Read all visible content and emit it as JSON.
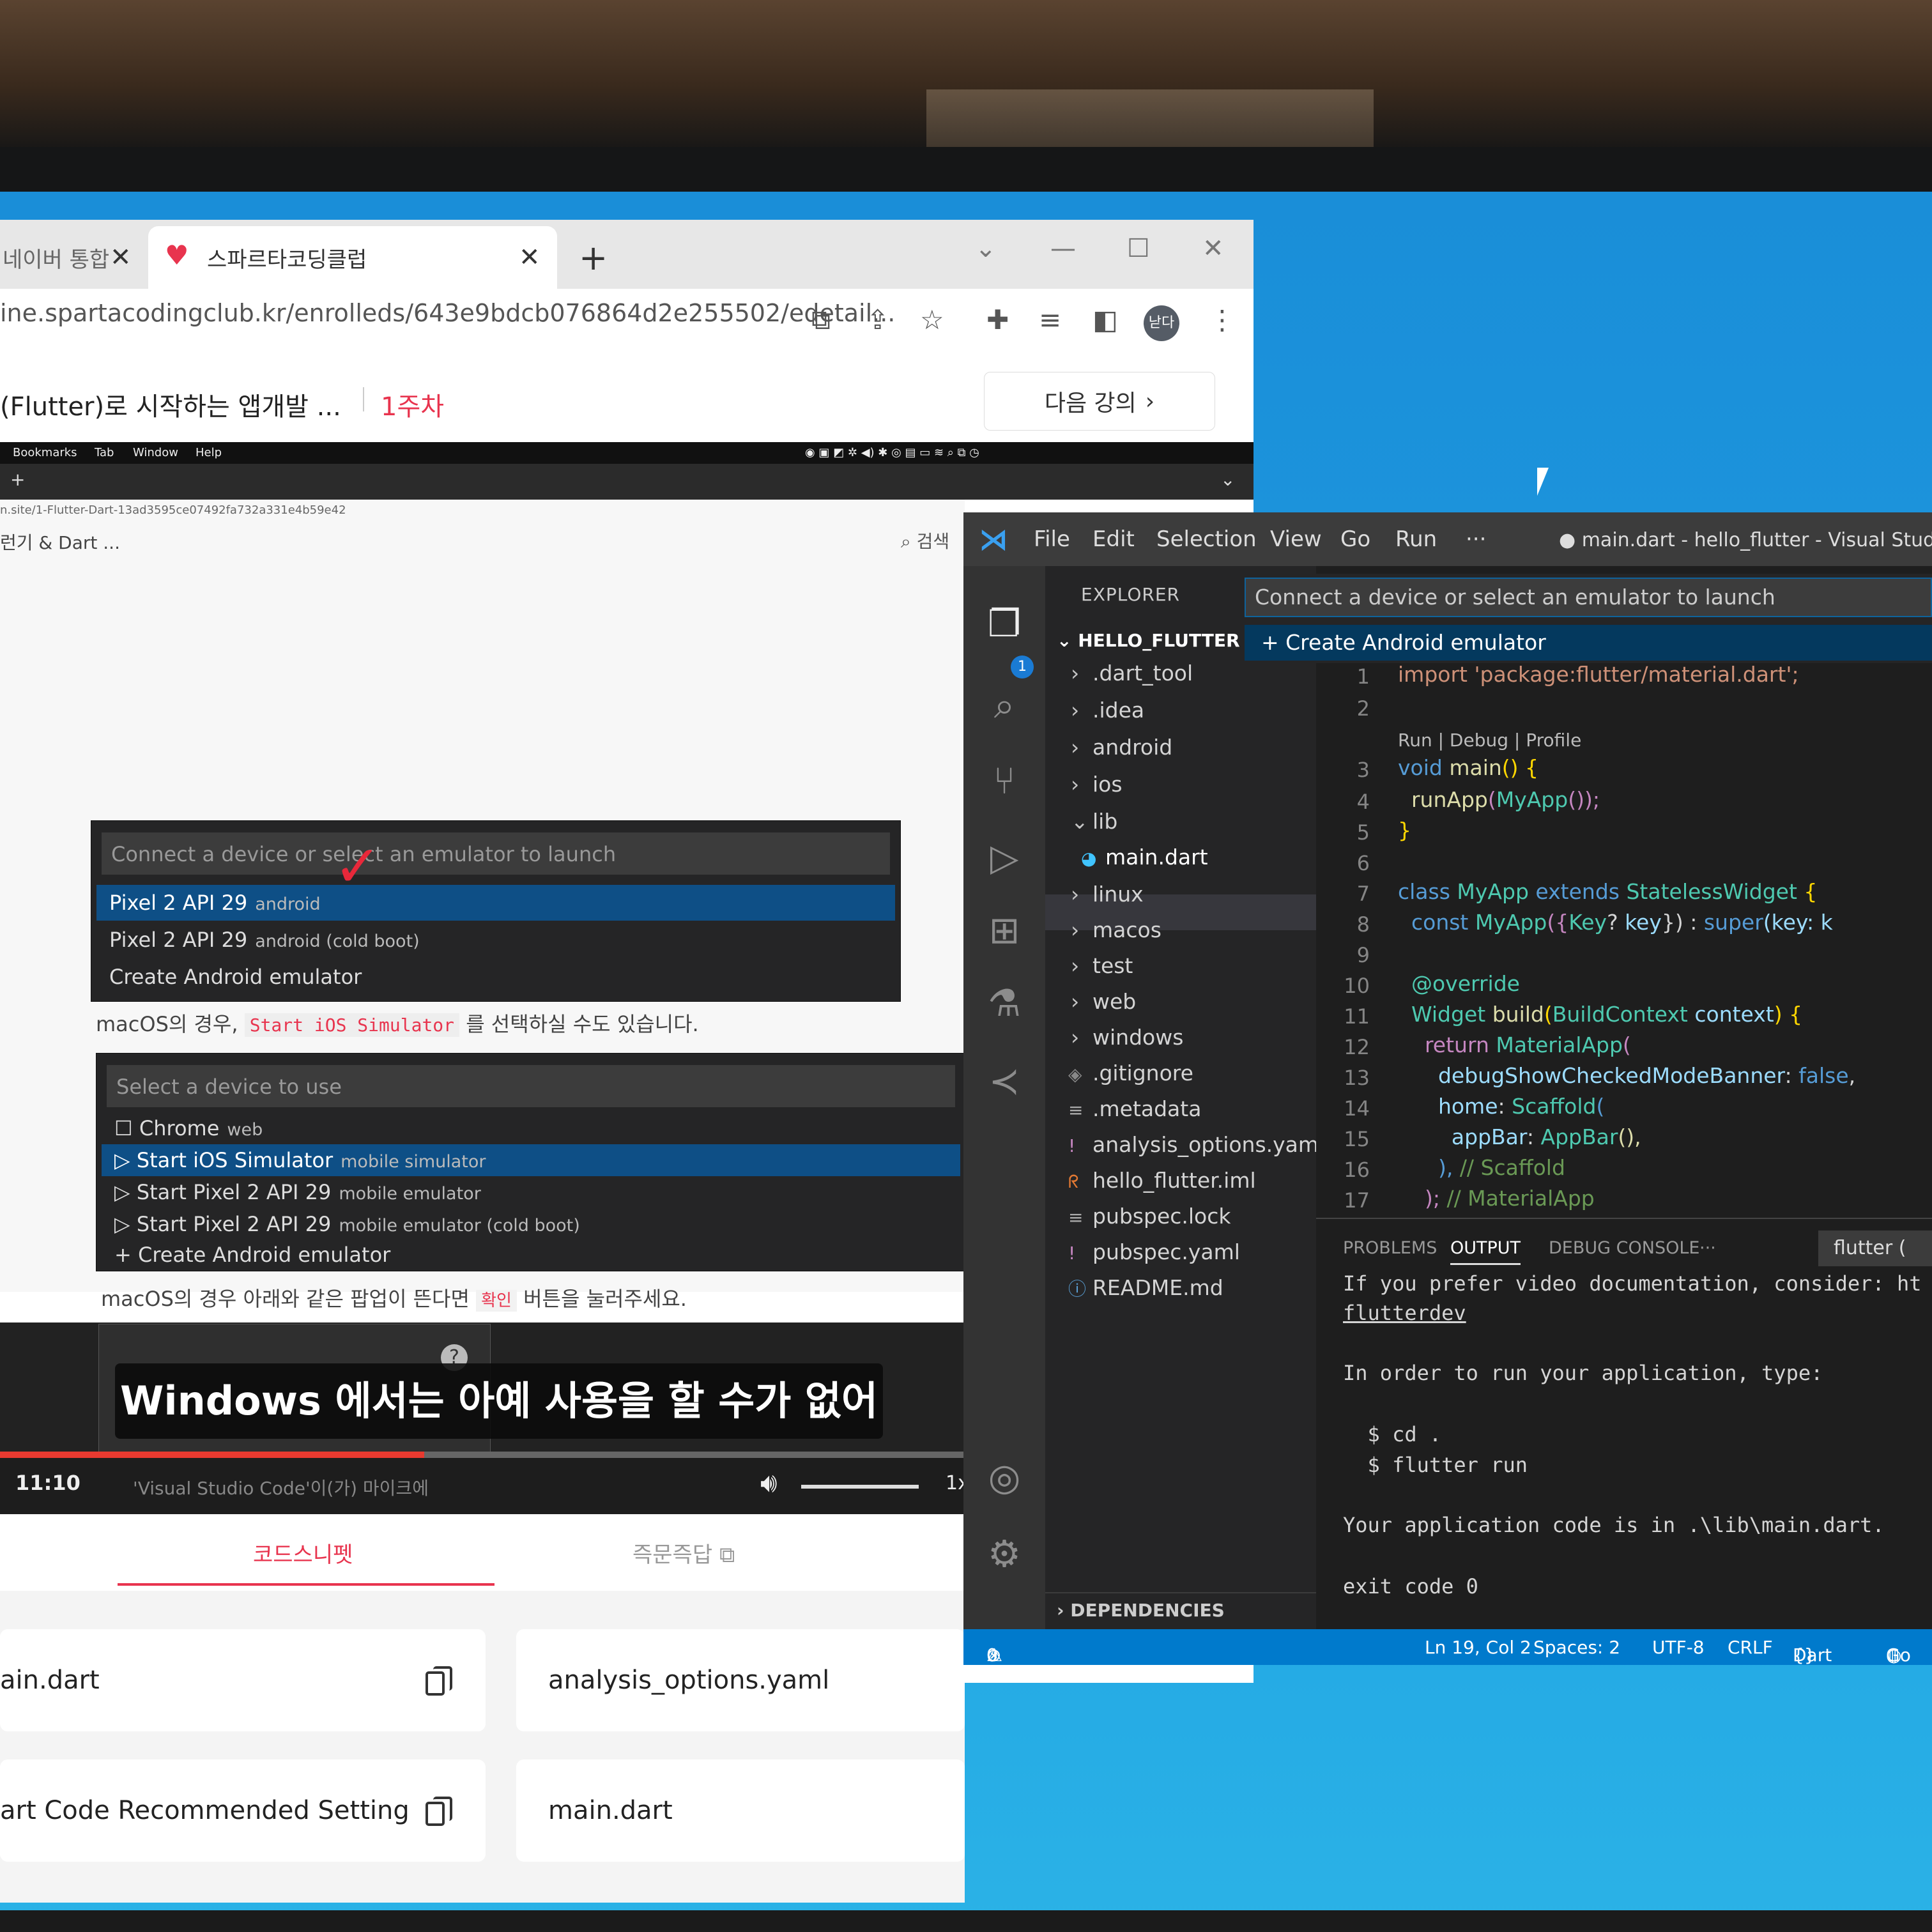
{
  "chrome": {
    "tab1_title": "네이버 통합",
    "tab2_title": "스파르타코딩클럽",
    "tab_close": "✕",
    "new_tab": "+",
    "url": "ine.spartacodingclub.kr/enrolleds/643e9bdcb076864d2e255502/edetail...",
    "profile_label": "낟다",
    "lecture_title": "(Flutter)로 시작하는 앱개발 ...",
    "week": "1주차",
    "next_lecture": "다음 강의"
  },
  "video": {
    "mac_menu": [
      "Bookmarks",
      "Tab",
      "Window",
      "Help"
    ],
    "mac_new_tab": "+",
    "inner_url": "n.site/1-Flutter-Dart-13ad3595ce07492fa732a331e4b59e42",
    "inner_heading": "런기 & Dart ...",
    "inner_search": "검색",
    "qp1": {
      "placeholder": "Connect a device or select an emulator to launch",
      "items": [
        {
          "name": "Pixel 2 API 29",
          "sub": "android"
        },
        {
          "name": "Pixel 2 API 29",
          "sub": "android (cold boot)"
        },
        {
          "name": "Create Android emulator",
          "sub": ""
        }
      ]
    },
    "para1_pre": "macOS의 경우,",
    "para1_code": "Start iOS Simulator",
    "para1_post": "를 선택하실 수도 있습니다.",
    "qp2": {
      "placeholder": "Select a device to use",
      "items": [
        {
          "name": "Chrome",
          "sub": "web"
        },
        {
          "name": "Start iOS Simulator",
          "sub": "mobile simulator"
        },
        {
          "name": "Start Pixel 2 API 29",
          "sub": "mobile emulator"
        },
        {
          "name": "Start Pixel 2 API 29",
          "sub": "mobile emulator (cold boot)"
        },
        {
          "name": "Create Android emulator",
          "sub": ""
        }
      ]
    },
    "para2_pre": "macOS의 경우 아래와 같은 팝업이 뜬다면",
    "para2_btn": "확인",
    "para2_post": "버튼을 눌러주세요.",
    "popup_q": "?",
    "subtitle": "Windows 에서는 아예 사용을 할 수가 없어요",
    "time": "11:10",
    "caption": "'Visual Studio Code'이(가) 마이크에",
    "speed": "1x",
    "progress": 0.44,
    "tabs": [
      "코드스니펫",
      "즉문즉답"
    ],
    "snippets": [
      "ain.dart",
      "analysis_options.yaml",
      "art Code Recommended Setting",
      "main.dart"
    ]
  },
  "vscode": {
    "menu": [
      "File",
      "Edit",
      "Selection",
      "View",
      "Go",
      "Run",
      "···"
    ],
    "title": "● main.dart - hello_flutter - Visual Studio Co",
    "explorer": "EXPLORER",
    "badge": "1",
    "project": "HELLO_FLUTTER",
    "tree": [
      ".dart_tool",
      ".idea",
      "android",
      "ios",
      "lib",
      "main.dart",
      "linux",
      "macos",
      "test",
      "web",
      "windows",
      ".gitignore",
      ".metadata",
      "analysis_options.yaml",
      "hello_flutter.iml",
      "pubspec.lock",
      "pubspec.yaml",
      "README.md"
    ],
    "dependencies": "DEPENDENCIES",
    "quickpick": {
      "placeholder": "Connect a device or select an emulator to launch",
      "item": "Create Android emulator"
    },
    "codelens": "Run | Debug | Profile",
    "line_numbers": [
      "1",
      "2",
      "3",
      "4",
      "5",
      "6",
      "7",
      "8",
      "9",
      "10",
      "11",
      "12",
      "13",
      "14",
      "15",
      "16",
      "17"
    ],
    "code": {
      "l1": "import 'package:flutter/material.dart';",
      "l3": [
        "void",
        " ",
        "main",
        "()",
        " {"
      ],
      "l4": [
        "  ",
        "runApp",
        "(",
        "MyApp",
        "());"
      ],
      "l5": "}",
      "l7": [
        "class",
        " ",
        "MyApp",
        " ",
        "extends",
        " ",
        "StatelessWidget",
        " {"
      ],
      "l8": [
        "  ",
        "const",
        " ",
        "MyApp",
        "({",
        "Key",
        "? ",
        "key",
        "}) : ",
        "super",
        "(key: k"
      ],
      "l10": "  @override",
      "l11": [
        "  ",
        "Widget",
        " ",
        "build",
        "(",
        "BuildContext",
        " ",
        "context",
        ") {"
      ],
      "l12": [
        "    ",
        "return",
        " ",
        "MaterialApp",
        "("
      ],
      "l13": [
        "      ",
        "debugShowCheckedModeBanner",
        ": ",
        "false",
        ","
      ],
      "l14": [
        "      ",
        "home",
        ": ",
        "Scaffold",
        "("
      ],
      "l15": [
        "        ",
        "appBar",
        ": ",
        "AppBar",
        "(),"
      ],
      "l16": [
        "      ",
        "), ",
        "// Scaffold"
      ],
      "l17": [
        "    ",
        "); ",
        "// MaterialApp"
      ]
    },
    "panel_tabs": [
      "PROBLEMS",
      "OUTPUT",
      "DEBUG CONSOLE",
      "···"
    ],
    "flutter_select": "flutter (",
    "output": [
      "If you prefer video documentation, consider: ht",
      "flutterdev",
      "In order to run your application, type:",
      "  $ cd .",
      "  $ flutter run",
      "Your application code is in .\\lib\\main.dart.",
      "exit code 0"
    ],
    "status": {
      "errors": "0",
      "warnings": "0",
      "position": "Ln 19, Col 2",
      "spaces": "Spaces: 2",
      "encoding": "UTF-8",
      "eol": "CRLF",
      "language": "Dart",
      "extra": "Go"
    }
  },
  "colors": {
    "desktop": "#1e9ae0",
    "accent_red": "#e8344e",
    "vscode_blue": "#007acc"
  }
}
